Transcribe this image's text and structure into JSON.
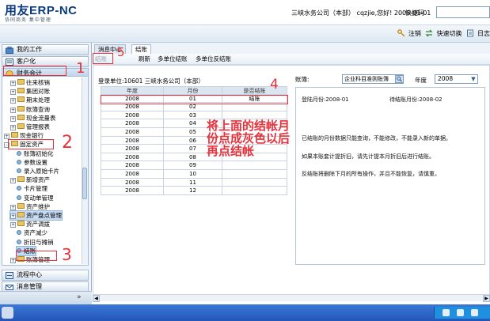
{
  "header": {
    "logo_text": "用友ERP-NC",
    "logo_sub": "协同商务  集中管理",
    "company_info": "三峡水务公司（本部） cqzjie,您好! 2008-01-01",
    "quick_label": "快捷码"
  },
  "toolbar": {
    "items": [
      {
        "label": "注销",
        "icon": "key-icon"
      },
      {
        "label": "快速切换",
        "icon": "switch-icon"
      },
      {
        "label": "日志",
        "icon": "log-icon"
      }
    ]
  },
  "sidebar": {
    "top_items": [
      {
        "label": "我的工作",
        "icon": "work-icon"
      },
      {
        "label": "客户化",
        "icon": "customize-icon"
      },
      {
        "label": "财务会计",
        "icon": "finance-icon"
      }
    ],
    "tree": [
      {
        "label": "往来核销",
        "type": "folder",
        "expand": "+"
      },
      {
        "label": "集团对账",
        "type": "folder",
        "expand": "+"
      },
      {
        "label": "期末处理",
        "type": "folder",
        "expand": "+"
      },
      {
        "label": "账簿查询",
        "type": "folder",
        "expand": "+"
      },
      {
        "label": "现金流量表",
        "type": "folder",
        "expand": "+"
      },
      {
        "label": "管理报表",
        "type": "folder",
        "expand": "+"
      },
      {
        "label": "现金银行",
        "type": "folder",
        "expand": "+"
      },
      {
        "label": "固定资产",
        "type": "folder",
        "expand": "-"
      },
      {
        "label": "账簿初始化",
        "type": "leaf"
      },
      {
        "label": "参数设置",
        "type": "leaf"
      },
      {
        "label": "录入原始卡片",
        "type": "leaf"
      },
      {
        "label": "新增资产",
        "type": "folder",
        "expand": "+"
      },
      {
        "label": "卡片管理",
        "type": "leaf"
      },
      {
        "label": "变动单管理",
        "type": "leaf"
      },
      {
        "label": "资产维护",
        "type": "folder",
        "expand": "+"
      },
      {
        "label": "资产盘点管理",
        "type": "folder",
        "expand": "+"
      },
      {
        "label": "资产调拨",
        "type": "folder",
        "expand": "+"
      },
      {
        "label": "资产减少",
        "type": "leaf"
      },
      {
        "label": "折旧与摊销",
        "type": "leaf"
      },
      {
        "label": "结账",
        "type": "leaf"
      },
      {
        "label": "账簿管理",
        "type": "folder",
        "expand": "+"
      }
    ],
    "bottom_items": [
      {
        "label": "流程中心",
        "icon": "flow-icon"
      },
      {
        "label": "消息管理",
        "icon": "message-icon"
      }
    ]
  },
  "tabs": [
    {
      "label": "消息中心"
    },
    {
      "label": "结账"
    }
  ],
  "subbar": {
    "buttons": [
      "结账",
      "刷新",
      "多单位结账",
      "多单位反结账"
    ]
  },
  "period_panel": {
    "unit_label": "登录单位:10601 三峡水务公司（本部）",
    "columns": [
      "年度",
      "月份",
      "是否结账"
    ],
    "rows": [
      {
        "year": "2008",
        "month": "01",
        "closed": "结账"
      },
      {
        "year": "2008",
        "month": "02",
        "closed": ""
      },
      {
        "year": "2008",
        "month": "03",
        "closed": ""
      },
      {
        "year": "2008",
        "month": "04",
        "closed": ""
      },
      {
        "year": "2008",
        "month": "05",
        "closed": ""
      },
      {
        "year": "2008",
        "month": "06",
        "closed": ""
      },
      {
        "year": "2008",
        "month": "07",
        "closed": ""
      },
      {
        "year": "2008",
        "month": "08",
        "closed": ""
      },
      {
        "year": "2008",
        "month": "09",
        "closed": ""
      },
      {
        "year": "2008",
        "month": "10",
        "closed": ""
      },
      {
        "year": "2008",
        "month": "11",
        "closed": ""
      },
      {
        "year": "2008",
        "month": "12",
        "closed": ""
      }
    ]
  },
  "right_panel": {
    "book_label": "账簿:",
    "book_value": "企业科目准则账簿",
    "year_label": "年度",
    "year_value": "2008",
    "login_month": "登陆月份:2008-01",
    "pending_month": "待结账月份:2008-02",
    "lines": [
      "已结账的月份数据只能查询，不能修改，不能录入新的单据。",
      "如果本账套计提折旧，请先计提本月折旧后进行结账。",
      "反结账将删除下月的所有操作，并且不能恢复，请慎重。"
    ]
  },
  "annotations": {
    "numbers": [
      "1",
      "2",
      "3",
      "4",
      "5"
    ],
    "note_lines": [
      "将上面的结帐月",
      "份点成灰色以后",
      "再点结帐"
    ]
  },
  "colors": {
    "annotation_red": "#e8313a",
    "accent_blue": "#0b3a7d"
  }
}
